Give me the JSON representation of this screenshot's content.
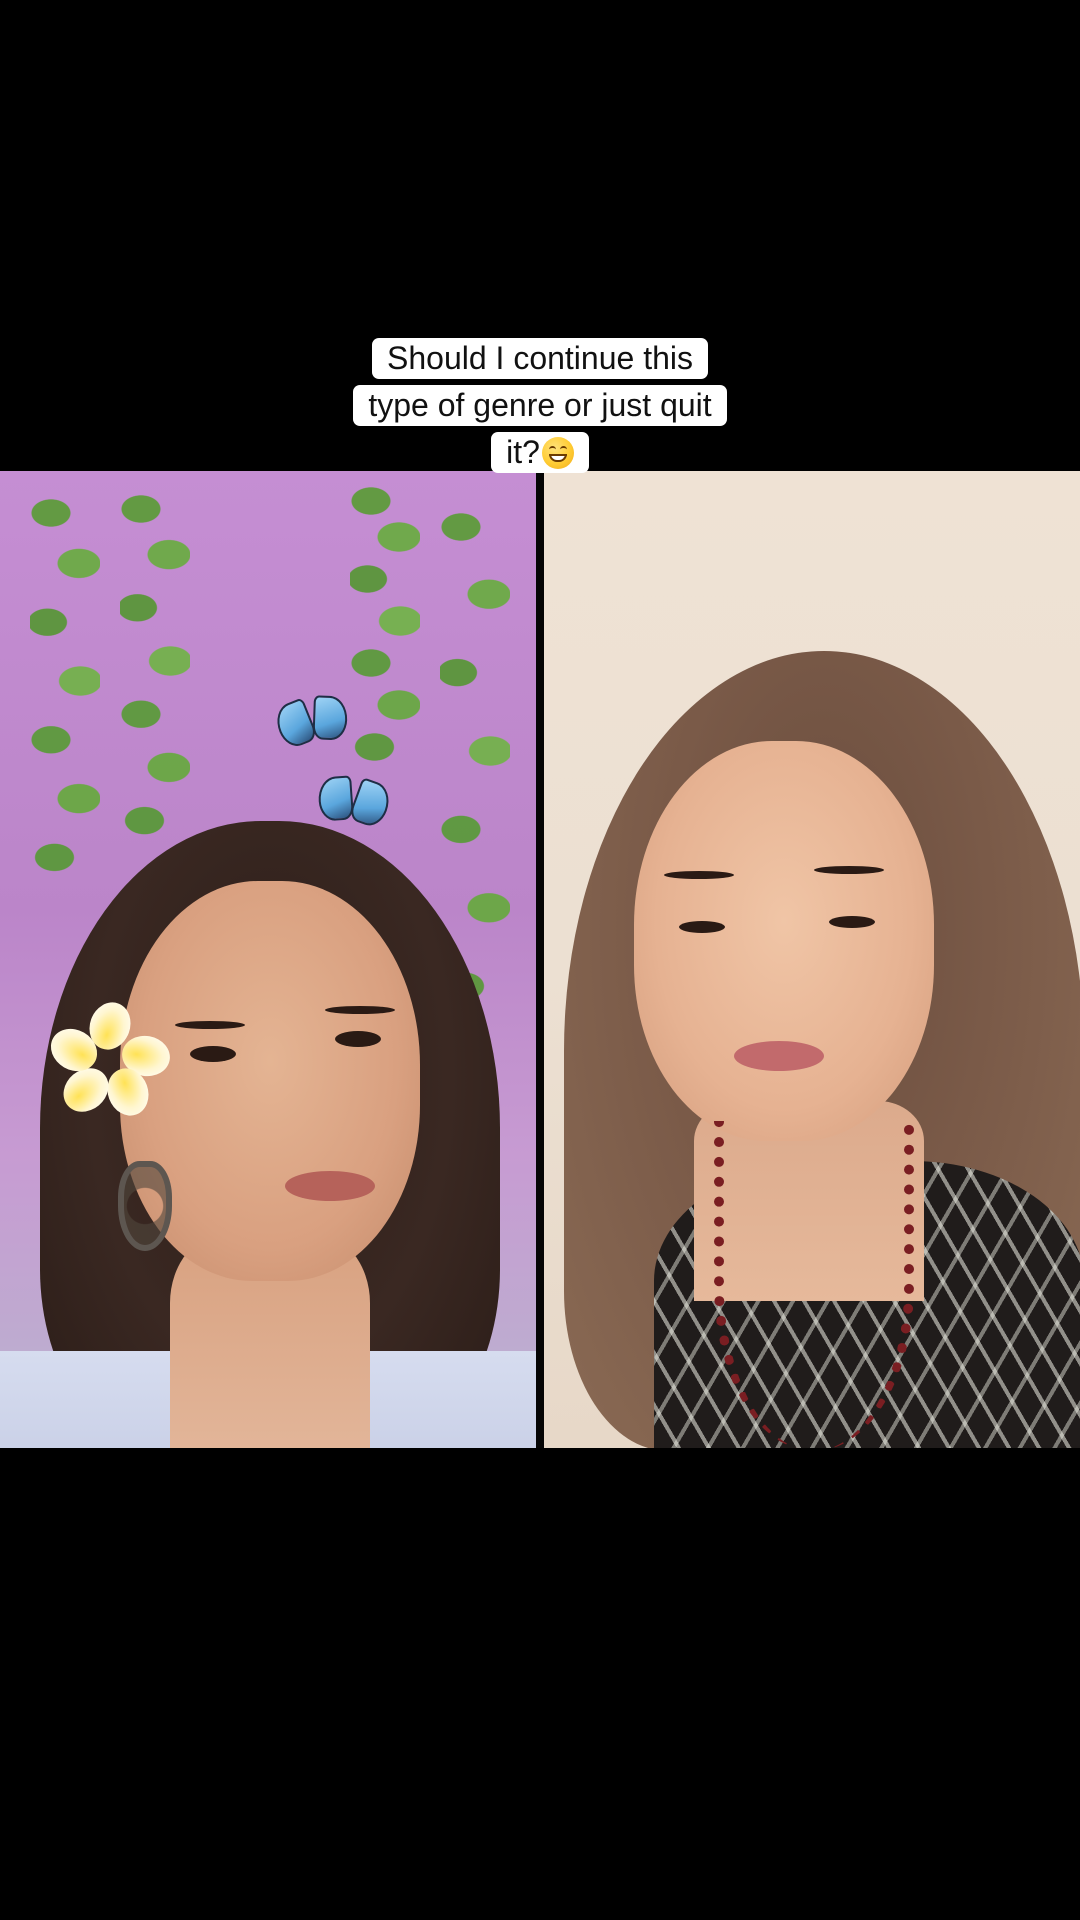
{
  "caption": {
    "lines": [
      "Should I continue this",
      "type of genre or just quit",
      "it?"
    ],
    "emoji": "grinning-face"
  },
  "panes": {
    "left": {
      "scene": "pink-wall-vines-butterflies"
    },
    "right": {
      "scene": "beige-wall"
    }
  },
  "colors": {
    "background": "#000000",
    "caption_bg": "#ffffff",
    "caption_text": "#111111"
  }
}
